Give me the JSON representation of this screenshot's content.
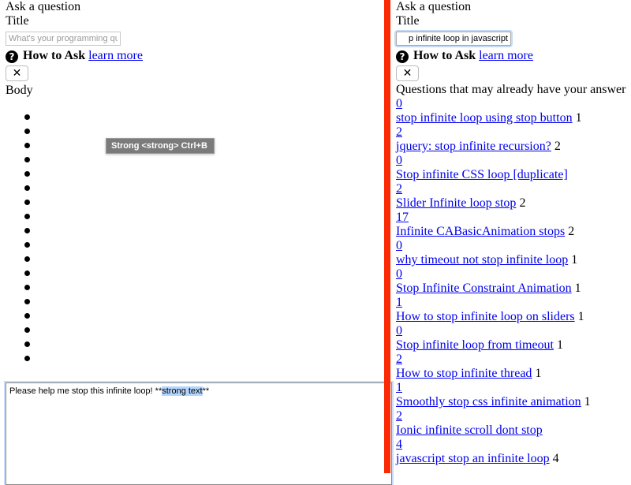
{
  "left": {
    "page_title": "Ask a question",
    "title_label": "Title",
    "title_input": {
      "value": "",
      "placeholder": "What's your programming question? Be specific."
    },
    "how_to_ask": {
      "icon": "question-circle-icon",
      "label": "How to Ask",
      "link": "learn more"
    },
    "close_button": {
      "icon": "close-icon",
      "label": "✕"
    },
    "body_label": "Body",
    "preview_bullets": 18,
    "tooltip": "Strong <strong> Ctrl+B",
    "editor": {
      "text_before": "Please help me stop this infinite loop! **",
      "selected": "strong text",
      "text_after": "**"
    }
  },
  "right": {
    "page_title": "Ask a question",
    "title_label": "Title",
    "title_input": {
      "value": "How to stop infinite loop in javascript",
      "visible": "p infinite loop in javascript"
    },
    "how_to_ask": {
      "icon": "question-circle-icon",
      "label": "How to Ask",
      "link": "learn more"
    },
    "close_button": {
      "icon": "close-icon",
      "label": "✕"
    },
    "similar_heading": "Questions that may already have your answer",
    "similar_questions": [
      {
        "votes": "0",
        "title": "stop infinite loop using stop button",
        "answers": "1"
      },
      {
        "votes": "2",
        "title": "jquery: stop infinite recursion?",
        "answers": "2"
      },
      {
        "votes": "0",
        "title": "Stop infinite CSS loop [duplicate]",
        "answers": ""
      },
      {
        "votes": "2",
        "title": "Slider Infinite loop stop",
        "answers": "2"
      },
      {
        "votes": "17",
        "title": "Infinite CABasicAnimation stops",
        "answers": "2"
      },
      {
        "votes": "0",
        "title": "why timeout not stop infinite loop",
        "answers": "1"
      },
      {
        "votes": "0",
        "title": "Stop Infinite Constraint Animation",
        "answers": "1"
      },
      {
        "votes": "1",
        "title": "How to stop infinite loop on sliders",
        "answers": "1"
      },
      {
        "votes": "0",
        "title": "Stop infinite loop from timeout",
        "answers": "1"
      },
      {
        "votes": "2",
        "title": "How to stop infinite thread",
        "answers": "1"
      },
      {
        "votes": "1",
        "title": "Smoothly stop css infinite animation",
        "answers": "1"
      },
      {
        "votes": "2",
        "title": "Ionic infinite scroll dont stop",
        "answers": ""
      },
      {
        "votes": "4",
        "title": "javascript stop an infinite loop",
        "answers": "4"
      }
    ]
  },
  "colors": {
    "divider": "#fc2a04",
    "link": "#0000ee",
    "selection": "#b4d5fe",
    "tooltip_bg": "#7b7b7b"
  }
}
